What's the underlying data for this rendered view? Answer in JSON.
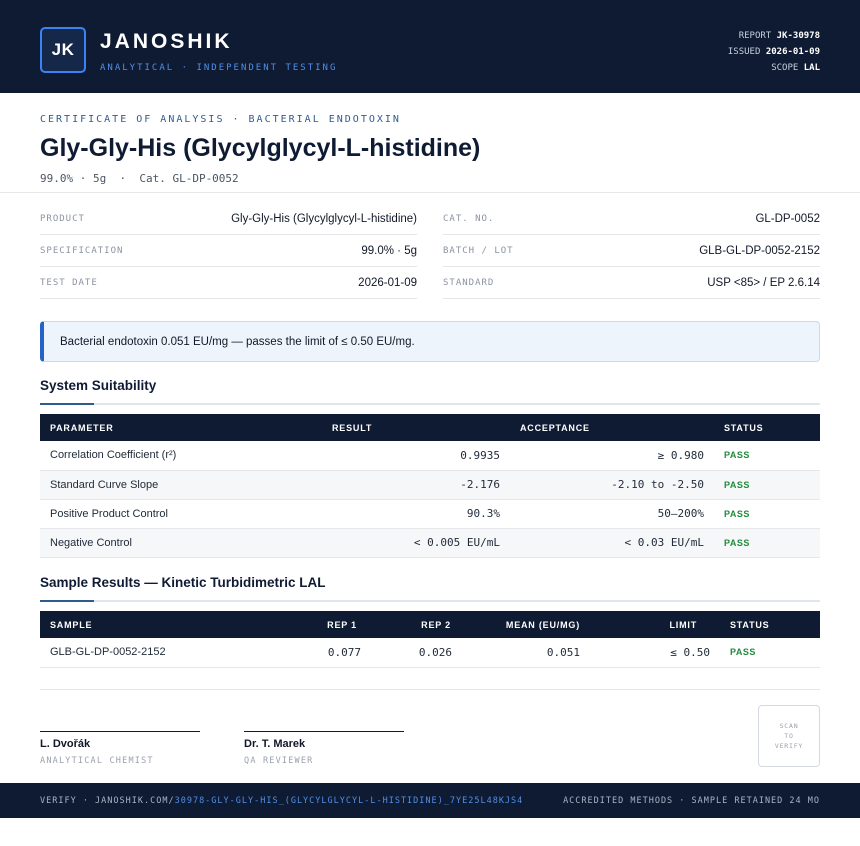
{
  "header": {
    "logo_initials": "JK",
    "brand": "JANOSHIK",
    "tagline": "ANALYTICAL · INDEPENDENT TESTING",
    "report_label": "REPORT",
    "report_value": "JK-30978",
    "issued_label": "ISSUED",
    "issued_value": "2026-01-09",
    "scope_label": "SCOPE",
    "scope_value": "LAL"
  },
  "document": {
    "kicker": "CERTIFICATE OF ANALYSIS · BACTERIAL ENDOTOXIN",
    "title": "Gly-Gly-His (Glycylglycyl-L-histidine)",
    "subtitle": "99.0% · 5g  ·  Cat. GL-DP-0052"
  },
  "info": {
    "product_label": "PRODUCT",
    "product_value": "Gly-Gly-His (Glycylglycyl-L-histidine)",
    "spec_label": "SPECIFICATION",
    "spec_value": "99.0% · 5g",
    "date_label": "TEST DATE",
    "date_value": "2026-01-09",
    "cat_label": "CAT. NO.",
    "cat_value": "GL-DP-0052",
    "batch_label": "BATCH / LOT",
    "batch_value": "GLB-GL-DP-0052-2152",
    "standard_label": "STANDARD",
    "standard_value": "USP <85> / EP 2.6.14"
  },
  "callout": {
    "text": "Bacterial endotoxin 0.051 EU/mg — passes the limit of ≤ 0.50 EU/mg."
  },
  "suitability": {
    "title": "System Suitability",
    "headers": {
      "parameter": "PARAMETER",
      "result": "RESULT",
      "acceptance": "ACCEPTANCE",
      "status": "STATUS"
    },
    "rows": [
      {
        "parameter": "Correlation Coefficient (r²)",
        "result": "0.9935",
        "acceptance": "≥ 0.980",
        "status": "PASS"
      },
      {
        "parameter": "Standard Curve Slope",
        "result": "-2.176",
        "acceptance": "-2.10 to -2.50",
        "status": "PASS"
      },
      {
        "parameter": "Positive Product Control",
        "result": "90.3%",
        "acceptance": "50–200%",
        "status": "PASS"
      },
      {
        "parameter": "Negative Control",
        "result": "< 0.005 EU/mL",
        "acceptance": "< 0.03 EU/mL",
        "status": "PASS"
      }
    ]
  },
  "samples": {
    "title": "Sample Results — Kinetic Turbidimetric LAL",
    "headers": {
      "sample": "SAMPLE",
      "rep1": "REP 1",
      "rep2": "REP 2",
      "mean": "MEAN (EU/MG)",
      "limit": "LIMIT",
      "status": "STATUS"
    },
    "rows": [
      {
        "sample": "GLB-GL-DP-0052-2152",
        "rep1": "0.077",
        "rep2": "0.026",
        "mean": "0.051",
        "limit": "≤ 0.50",
        "status": "PASS"
      }
    ]
  },
  "signatures": {
    "chemist_name": "L. Dvořák",
    "chemist_role": "ANALYTICAL CHEMIST",
    "reviewer_name": "Dr. T. Marek",
    "reviewer_role": "QA REVIEWER",
    "qr_line1": "SCAN",
    "qr_line2": "TO",
    "qr_line3": "VERIFY"
  },
  "footer": {
    "verify_prefix": "VERIFY · JANOSHIK.COM/",
    "verify_path": "30978-GLY-GLY-HIS_(GLYCYLGLYCYL-L-HISTIDINE)_7YE25L48KJS4",
    "right_text": "ACCREDITED METHODS · SAMPLE RETAINED 24 MO"
  },
  "colors": {
    "navy": "#0f1b33",
    "accent_blue": "#2563c9",
    "pass_green": "#1f8a3a"
  }
}
